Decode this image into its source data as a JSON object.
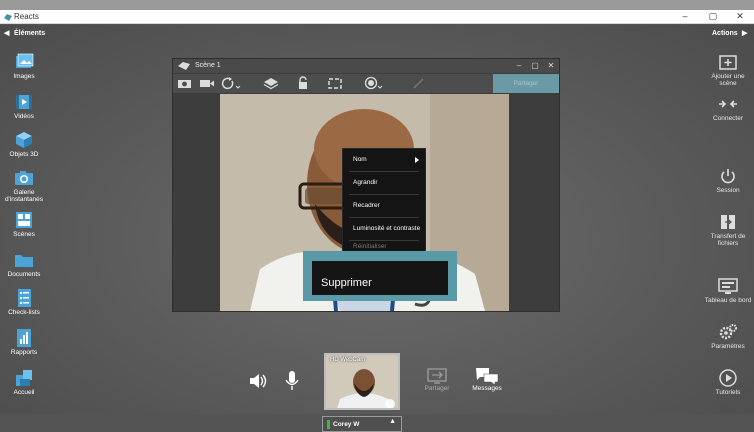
{
  "window": {
    "title": "Reacts",
    "minimize": "–",
    "maximize": "▢",
    "close": "✕"
  },
  "left_sidebar": {
    "header": "Éléments",
    "items": [
      {
        "label": "Images",
        "icon": "images-icon"
      },
      {
        "label": "Vidéos",
        "icon": "videos-icon"
      },
      {
        "label": "Objets 3D",
        "icon": "cube-icon"
      },
      {
        "label": "Galerie d'instantanés",
        "icon": "camera-icon"
      },
      {
        "label": "Scènes",
        "icon": "scenes-icon"
      },
      {
        "label": "Documents",
        "icon": "folder-icon"
      },
      {
        "label": "Check-lists",
        "icon": "checklist-icon"
      },
      {
        "label": "Rapports",
        "icon": "reports-icon"
      },
      {
        "label": "Accueil",
        "icon": "home-icon"
      }
    ]
  },
  "right_sidebar": {
    "header": "Actions",
    "items": [
      {
        "label": "Ajouter une scène",
        "icon": "add-scene-icon"
      },
      {
        "label": "Connecter",
        "icon": "connect-icon"
      },
      {
        "label": "Session",
        "icon": "power-icon"
      },
      {
        "label": "Transfert de fichiers",
        "icon": "file-transfer-icon"
      },
      {
        "label": "Tableau de bord",
        "icon": "dashboard-icon"
      },
      {
        "label": "Paramètres",
        "icon": "gears-icon"
      },
      {
        "label": "Tutoriels",
        "icon": "tutorials-icon"
      }
    ]
  },
  "scene": {
    "title": "Scène 1",
    "share_label": "Partager",
    "toolbar_icons": [
      "snapshot-icon",
      "video-camera-icon",
      "rotate-icon",
      "layers-icon",
      "lock-icon",
      "crop-icon",
      "record-icon",
      "pen-icon"
    ]
  },
  "context_menu": {
    "items": [
      "Nom",
      "Agrandir",
      "Recadrer",
      "Luminosité et contraste",
      "Réinitialiser"
    ],
    "highlighted": "Supprimer"
  },
  "bottom_bar": {
    "share_label": "Partager",
    "messages_label": "Messages",
    "webcam_label": "HD WebCam",
    "participant_name": "Corey W"
  },
  "colors": {
    "accent": "#5a9aa6",
    "status_green": "#3fb54a"
  }
}
